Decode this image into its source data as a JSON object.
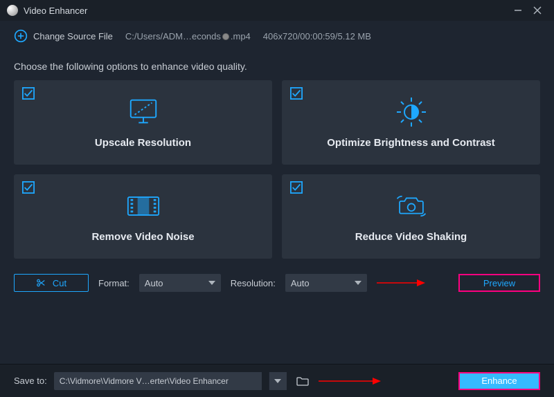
{
  "window": {
    "title": "Video Enhancer"
  },
  "toolbar": {
    "change_source": "Change Source File",
    "filepath_left": "C:/Users/ADM…econds",
    "filepath_ext": ".mp4",
    "fileinfo": "406x720/00:00:59/5.12 MB"
  },
  "instruction": "Choose the following options to enhance video quality.",
  "cards": {
    "upscale": "Upscale Resolution",
    "brightness": "Optimize Brightness and Contrast",
    "denoise": "Remove Video Noise",
    "stabilize": "Reduce Video Shaking"
  },
  "controls": {
    "cut": "Cut",
    "format_label": "Format:",
    "format_value": "Auto",
    "resolution_label": "Resolution:",
    "resolution_value": "Auto",
    "preview": "Preview"
  },
  "footer": {
    "save_label": "Save to:",
    "path": "C:\\Vidmore\\Vidmore V…erter\\Video Enhancer",
    "enhance": "Enhance"
  }
}
